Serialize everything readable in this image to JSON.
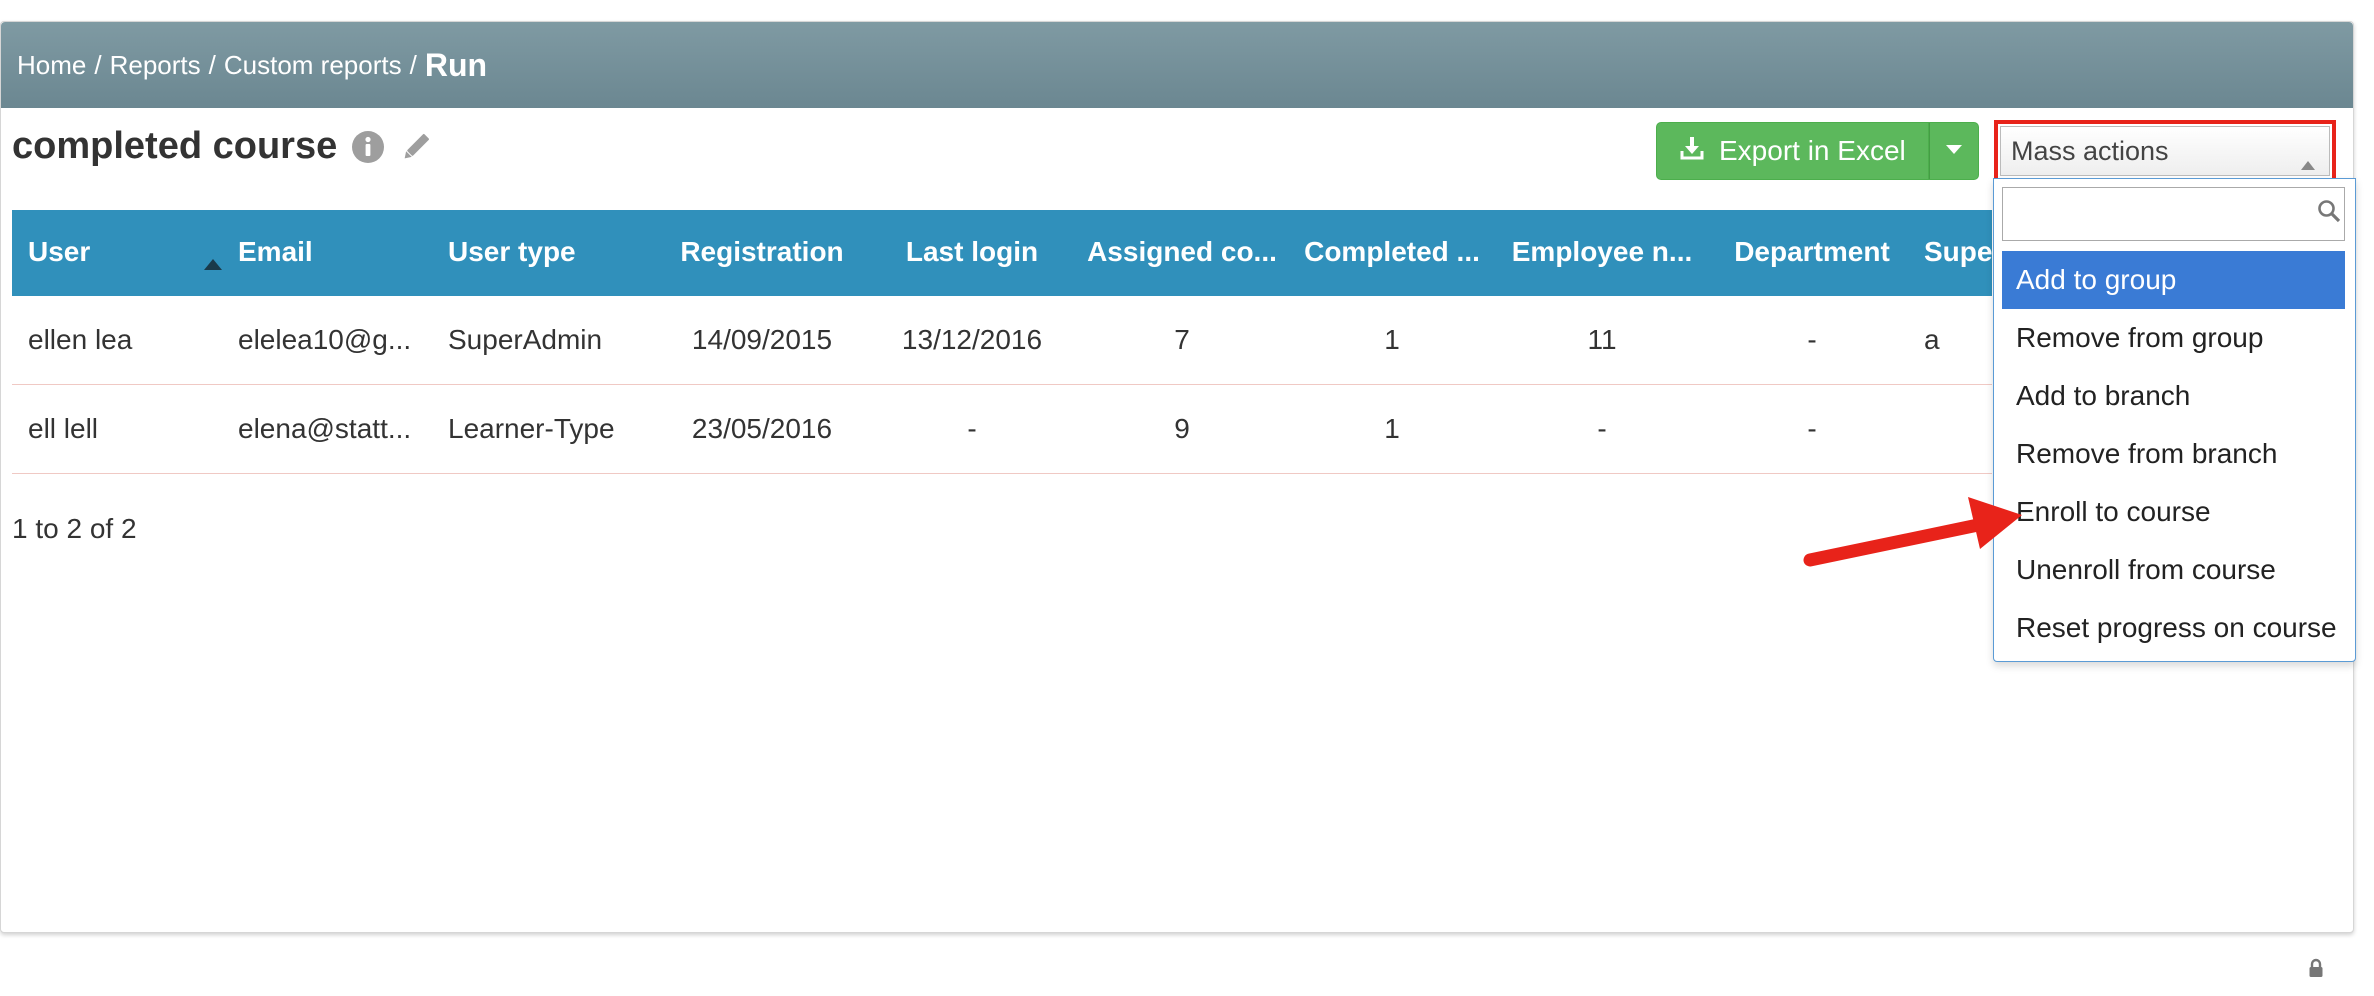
{
  "breadcrumb": {
    "items": [
      "Home",
      "Reports",
      "Custom reports"
    ],
    "separator": "/",
    "current": "Run"
  },
  "page": {
    "title": "completed course"
  },
  "toolbar": {
    "export_label": "Export in Excel",
    "mass_actions_label": "Mass actions"
  },
  "table": {
    "columns": [
      "User",
      "Email",
      "User type",
      "Registration",
      "Last login",
      "Assigned co...",
      "Completed ...",
      "Employee n...",
      "Department",
      "Supe"
    ],
    "rows": [
      [
        "ellen lea",
        "elelea10@g...",
        "SuperAdmin",
        "14/09/2015",
        "13/12/2016",
        "7",
        "1",
        "11",
        "-",
        "a"
      ],
      [
        "ell lell",
        "elena@statt...",
        "Learner-Type",
        "23/05/2016",
        "-",
        "9",
        "1",
        "-",
        "-",
        ""
      ]
    ]
  },
  "pagination": {
    "text": "1 to 2 of 2"
  },
  "mass_actions_menu": {
    "search_value": "",
    "items": [
      "Add to group",
      "Remove from group",
      "Add to branch",
      "Remove from branch",
      "Enroll to course",
      "Unenroll from course",
      "Reset progress on course"
    ],
    "highlighted_index": 0
  },
  "colors": {
    "header_bar": "#6b8791",
    "table_header": "#3090bb",
    "export_button": "#5cb85c",
    "highlight_box": "#e8231a",
    "menu_highlight": "#3a7bd5",
    "annotation_arrow": "#e8231a"
  },
  "icons": [
    "info-icon",
    "pencil-icon",
    "download-icon",
    "caret-down-icon",
    "sort-asc-icon",
    "search-icon",
    "lock-icon"
  ]
}
